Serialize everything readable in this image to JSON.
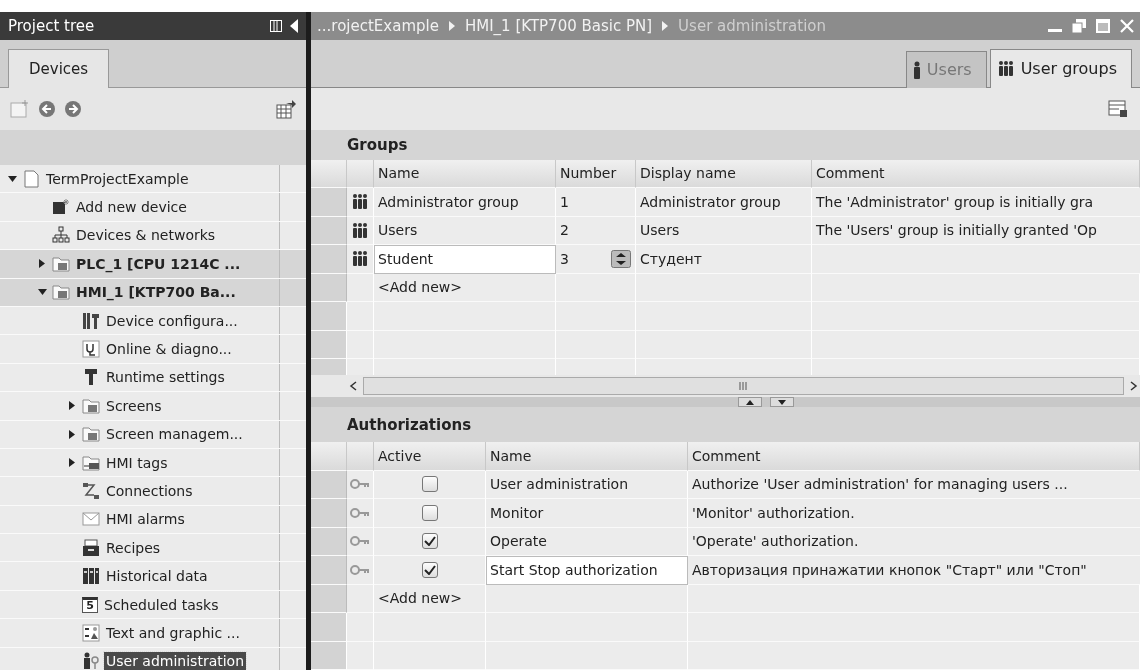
{
  "project_tree": {
    "title": "Project tree",
    "tabs": [
      {
        "label": "Devices",
        "selected": true
      }
    ],
    "items": [
      {
        "label": "TermProjectExample",
        "kind": "project",
        "selected": false,
        "expanded": true,
        "children": [
          {
            "label": "Add new device",
            "kind": "add-device",
            "selected": false
          },
          {
            "label": "Devices & networks",
            "kind": "network",
            "selected": false
          },
          {
            "label": "PLC_1 [CPU 1214C ...",
            "kind": "device",
            "selected": false,
            "expanded": false
          },
          {
            "label": "HMI_1 [KTP700 Ba...",
            "kind": "device",
            "selected": false,
            "expanded": true,
            "children": [
              {
                "label": "Device configura...",
                "kind": "config",
                "selected": false
              },
              {
                "label": "Online & diagno...",
                "kind": "diagnostics",
                "selected": false
              },
              {
                "label": "Runtime settings",
                "kind": "runtime",
                "selected": false
              },
              {
                "label": "Screens",
                "kind": "folder",
                "selected": false,
                "expanded": false
              },
              {
                "label": "Screen managem...",
                "kind": "folder",
                "selected": false,
                "expanded": false
              },
              {
                "label": "HMI tags",
                "kind": "tag-folder",
                "selected": false,
                "expanded": false
              },
              {
                "label": "Connections",
                "kind": "connections",
                "selected": false
              },
              {
                "label": "HMI alarms",
                "kind": "alarms",
                "selected": false
              },
              {
                "label": "Recipes",
                "kind": "recipes",
                "selected": false
              },
              {
                "label": "Historical data",
                "kind": "historical",
                "selected": false
              },
              {
                "label": "Scheduled tasks",
                "kind": "schedule",
                "icon_text": "5",
                "selected": false
              },
              {
                "label": "Text and graphic ...",
                "kind": "text-lists",
                "selected": false
              },
              {
                "label": "User administration",
                "kind": "users",
                "selected": true
              }
            ]
          }
        ]
      }
    ]
  },
  "editor": {
    "breadcrumb": [
      "...rojectExample",
      "HMI_1 [KTP700 Basic PN]",
      "User administration"
    ],
    "tabs": [
      {
        "label": "Users",
        "selected": false
      },
      {
        "label": "User groups",
        "selected": true
      }
    ],
    "groups": {
      "title": "Groups",
      "columns": [
        "Name",
        "Number",
        "Display name",
        "Comment"
      ],
      "rows": [
        {
          "name": "Administrator group",
          "number": "1",
          "display_name": "Administrator group",
          "comment": "The 'Administrator' group is initially gra",
          "editing": false
        },
        {
          "name": "Users",
          "number": "2",
          "display_name": "Users",
          "comment": "The 'Users' group is initially granted 'Op",
          "editing": false
        },
        {
          "name": "Student",
          "number": "3",
          "display_name": "Студент",
          "editing": true
        }
      ],
      "add_new": "<Add new>"
    },
    "authorizations": {
      "title": "Authorizations",
      "columns": [
        "Active",
        "Name",
        "Comment"
      ],
      "rows": [
        {
          "active": false,
          "name": "User administration",
          "comment": "Authorize 'User administration' for managing users ...",
          "editing": false
        },
        {
          "active": false,
          "name": "Monitor",
          "comment": "'Monitor' authorization.",
          "editing": false
        },
        {
          "active": true,
          "name": "Operate",
          "comment": "'Operate' authorization.",
          "editing": false
        },
        {
          "active": true,
          "name": "Start Stop authorization",
          "comment": "Авторизация принажатии кнопок \"Старт\" или \"Стоп\"",
          "editing": true
        }
      ],
      "add_new": "<Add new>"
    }
  }
}
